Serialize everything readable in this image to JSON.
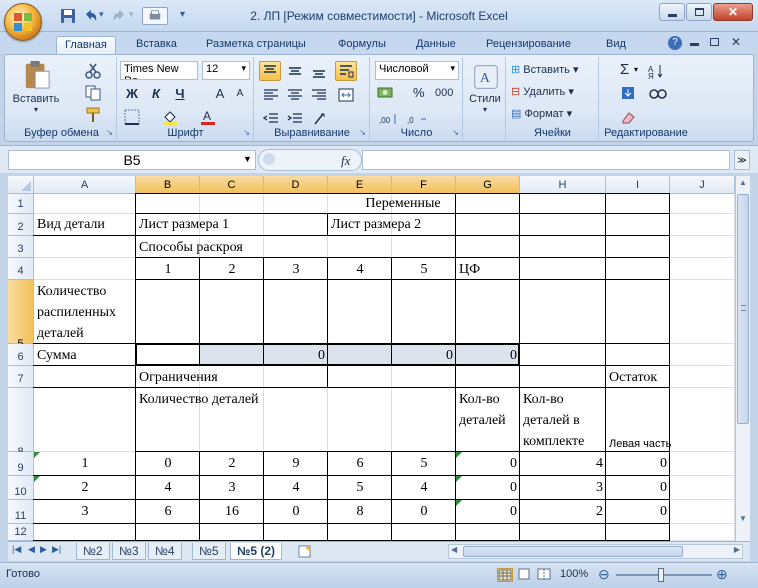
{
  "window": {
    "title": "2. ЛП  [Режим совместимости] - Microsoft Excel"
  },
  "qat": {
    "customize": "▾"
  },
  "tabs": [
    "Главная",
    "Вставка",
    "Разметка страницы",
    "Формулы",
    "Данные",
    "Рецензирование",
    "Вид"
  ],
  "ribbon": {
    "clipboard": {
      "label": "Буфер обмена",
      "paste": "Вставить"
    },
    "font": {
      "label": "Шрифт",
      "name": "Times New Ro",
      "size": "12",
      "bold": "Ж",
      "italic": "К",
      "underline": "Ч",
      "grow": "A",
      "shrink": "A"
    },
    "align": {
      "label": "Выравнивание"
    },
    "number": {
      "label": "Число",
      "format": "Числовой",
      "percent": "%",
      "thousands": "000"
    },
    "styles": {
      "label": "Стили",
      "btn": "Стили"
    },
    "cells": {
      "label": "Ячейки",
      "insert": "Вставить",
      "delete": "Удалить",
      "format": "Формат"
    },
    "editing": {
      "label": "Редактирование",
      "sum": "Σ"
    }
  },
  "formula_bar": {
    "name_box": "B5",
    "fx": "fx",
    "value": ""
  },
  "columns": [
    "A",
    "B",
    "C",
    "D",
    "E",
    "F",
    "G",
    "H",
    "I",
    "J"
  ],
  "rows": [
    "1",
    "2",
    "3",
    "4",
    "5",
    "6",
    "7",
    "8",
    "9",
    "10",
    "11",
    "12"
  ],
  "cells": {
    "c1": "Переменные",
    "a2": "Вид детали",
    "b2": "Лист размера 1",
    "e2": "Лист размера 2",
    "b3": "Способы раскроя",
    "b4": "1",
    "c4": "2",
    "d4": "3",
    "e4": "4",
    "f4": "5",
    "g4": "ЦФ",
    "a5_1": "Количество",
    "a5_2": "распиленных",
    "a5_3": "деталей",
    "a6": "Сумма",
    "d6": "0",
    "f6": "0",
    "g6": "0",
    "b7": "Ограничения",
    "i7": "Остаток",
    "b8": "Количество деталей",
    "g8_1": "Кол-во",
    "g8_2": "деталей",
    "h8_1": "Кол-во",
    "h8_2": "деталей в",
    "h8_3": "комплекте",
    "i8": "Левая часть",
    "r9": [
      "1",
      "0",
      "2",
      "9",
      "6",
      "5",
      "0",
      "4",
      "0"
    ],
    "r10": [
      "2",
      "4",
      "3",
      "4",
      "5",
      "4",
      "0",
      "3",
      "0"
    ],
    "r11": [
      "3",
      "6",
      "16",
      "0",
      "8",
      "0",
      "0",
      "2",
      "0"
    ]
  },
  "sheets": [
    "№2",
    "№3",
    "№4",
    "№5",
    "№5 (2)"
  ],
  "status": {
    "ready": "Готово",
    "zoom": "100%"
  }
}
